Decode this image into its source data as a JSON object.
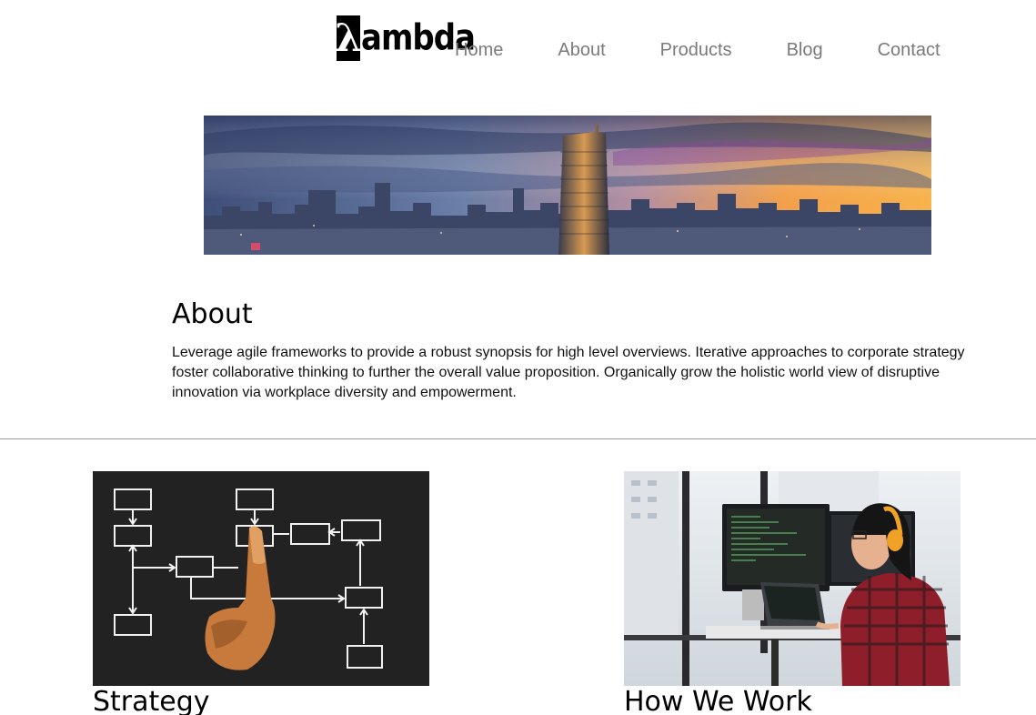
{
  "header": {
    "logo_mark": "λ",
    "logo_text": "ambda",
    "nav": [
      "Home",
      "About",
      "Products",
      "Blog",
      "Contact"
    ]
  },
  "about": {
    "title": "About",
    "text": "Leverage agile frameworks to provide a robust synopsis for high level overviews. Iterative approaches to corporate strategy foster collaborative thinking to further the overall value proposition. Organically grow the holistic world view of disruptive innovation via workplace diversity and empowerment."
  },
  "features": [
    {
      "title": "Strategy",
      "image": "flowchart-hand-image"
    },
    {
      "title": "How We Work",
      "image": "developer-at-monitors-image"
    }
  ],
  "colors": {
    "nav_text": "#7a7a7a",
    "divider": "#9a9a9a"
  }
}
